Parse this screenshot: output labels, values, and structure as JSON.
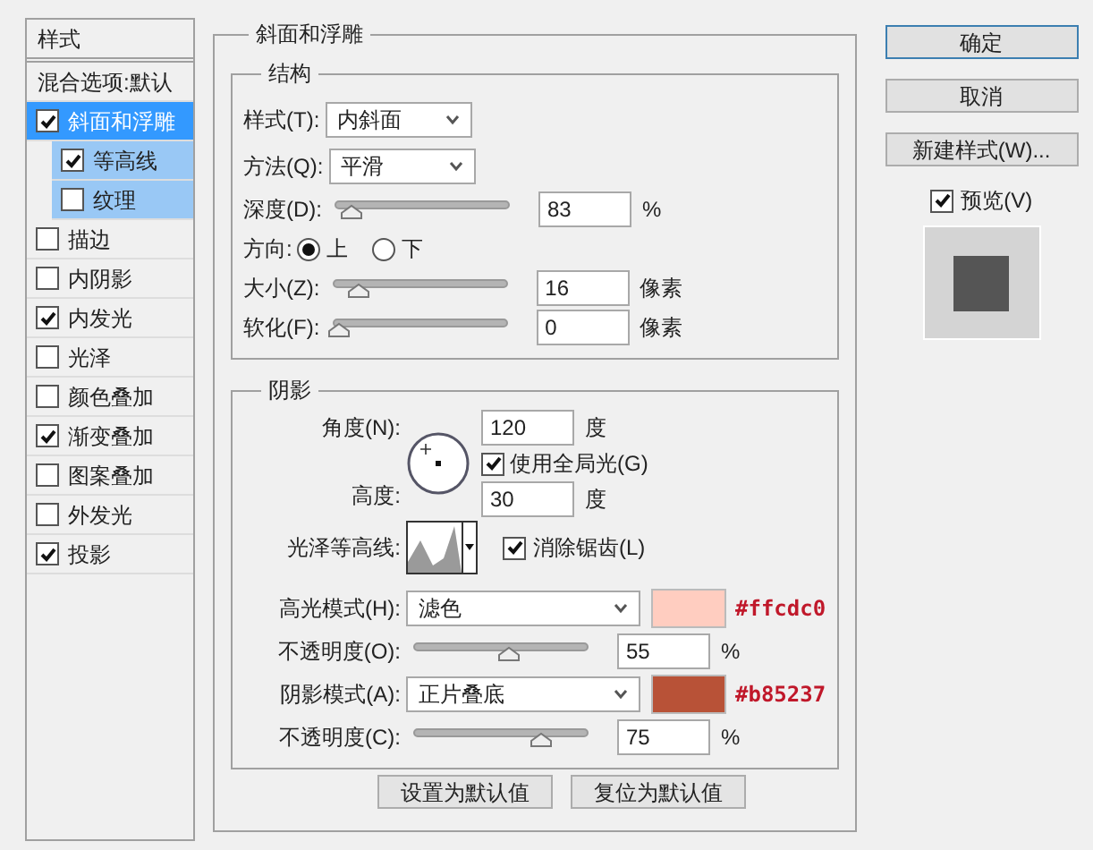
{
  "sidebar": {
    "header": "样式",
    "blend_options": "混合选项:默认",
    "items": [
      {
        "label": "斜面和浮雕",
        "checked": true,
        "selected": true,
        "children": [
          {
            "label": "等高线",
            "checked": true,
            "selected": false
          },
          {
            "label": "纹理",
            "checked": false,
            "selected": false
          }
        ]
      },
      {
        "label": "描边",
        "checked": false,
        "selected": false
      },
      {
        "label": "内阴影",
        "checked": false,
        "selected": false
      },
      {
        "label": "内发光",
        "checked": true,
        "selected": false
      },
      {
        "label": "光泽",
        "checked": false,
        "selected": false
      },
      {
        "label": "颜色叠加",
        "checked": false,
        "selected": false
      },
      {
        "label": "渐变叠加",
        "checked": true,
        "selected": false
      },
      {
        "label": "图案叠加",
        "checked": false,
        "selected": false
      },
      {
        "label": "外发光",
        "checked": false,
        "selected": false
      },
      {
        "label": "投影",
        "checked": true,
        "selected": false
      }
    ]
  },
  "bevel": {
    "title": "斜面和浮雕",
    "structure": {
      "title": "结构",
      "rows": [
        {
          "kind": "select",
          "label": "样式(T):",
          "value": "内斜面"
        },
        {
          "kind": "select",
          "label": "方法(Q):",
          "value": "平滑"
        },
        {
          "kind": "slider",
          "label": "深度(D):",
          "level": 0.07,
          "value": "83",
          "unit": "%"
        },
        {
          "kind": "radio",
          "label": "方向:",
          "options": [
            {
              "label": "上",
              "selected": true
            },
            {
              "label": "下",
              "selected": false
            }
          ]
        },
        {
          "kind": "slider",
          "label": "大小(Z):",
          "level": 0.12,
          "value": "16",
          "unit": "像素"
        },
        {
          "kind": "slider",
          "label": "软化(F):",
          "level": 0,
          "value": "0",
          "unit": "像素"
        }
      ]
    },
    "shading": {
      "title": "阴影",
      "angle_label": "角度(N):",
      "angle": "120",
      "angle_unit": "度",
      "global_light": {
        "label": "使用全局光(G)",
        "checked": true
      },
      "altitude_label": "高度:",
      "altitude": "30",
      "altitude_unit": "度",
      "gloss_label": "光泽等高线:",
      "anti_alias": {
        "label": "消除锯齿(L)",
        "checked": true
      },
      "rows": [
        {
          "kind": "mode",
          "label": "高光模式(H):",
          "value": "滤色",
          "color": "#ffcdc0",
          "note": "#ffcdc0"
        },
        {
          "kind": "slider",
          "label": "不透明度(O):",
          "level": 0.55,
          "value": "55",
          "unit": "%"
        },
        {
          "kind": "mode",
          "label": "阴影模式(A):",
          "value": "正片叠底",
          "color": "#b85237",
          "note": "#b85237"
        },
        {
          "kind": "slider",
          "label": "不透明度(C):",
          "level": 0.75,
          "value": "75",
          "unit": "%"
        }
      ]
    },
    "buttons": [
      "设置为默认值",
      "复位为默认值"
    ]
  },
  "actions": {
    "buttons": [
      {
        "label": "确定",
        "default": true
      },
      {
        "label": "取消",
        "default": false
      },
      {
        "label": "新建样式(W)...",
        "default": false
      }
    ],
    "preview": {
      "label": "预览(V)",
      "checked": true
    }
  }
}
